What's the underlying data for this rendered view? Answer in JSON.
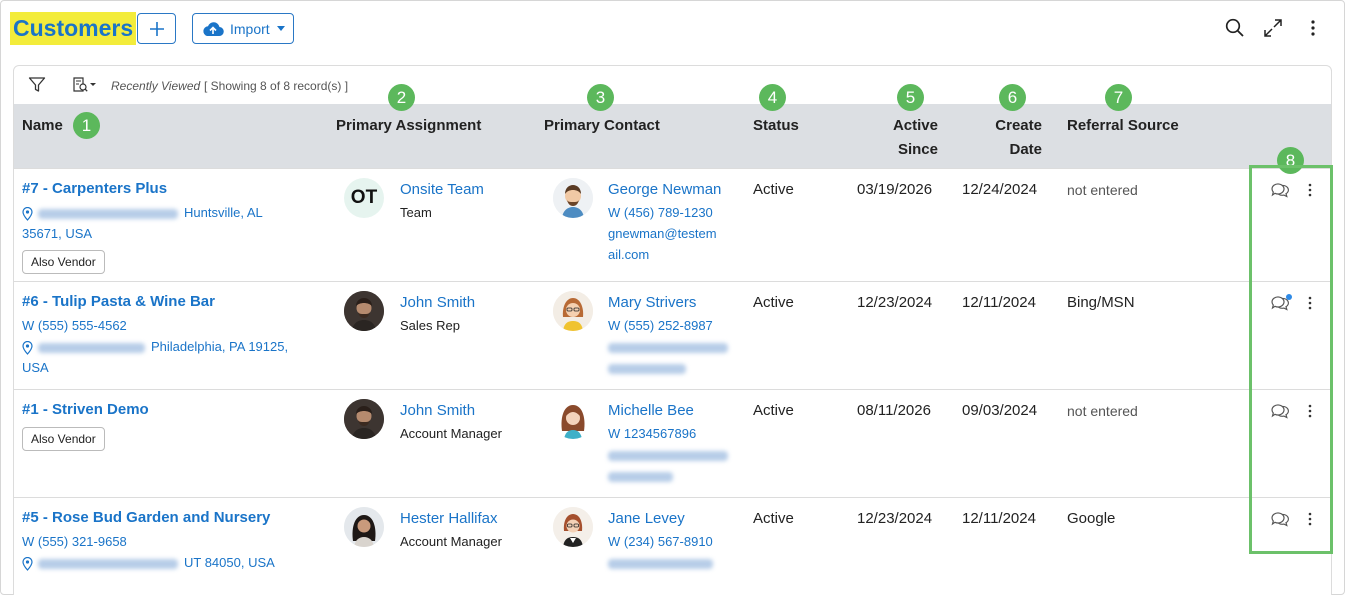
{
  "page": {
    "title": "Customers",
    "import_label": "Import"
  },
  "toolbar": {
    "recently_viewed": "Recently Viewed",
    "showing": "[ Showing 8 of 8 record(s) ]"
  },
  "columns": {
    "name": "Name",
    "primary_assignment": "Primary Assignment",
    "primary_contact": "Primary Contact",
    "status": "Status",
    "active_since_1": "Active",
    "active_since_2": "Since",
    "create_date_1": "Create",
    "create_date_2": "Date",
    "referral_source": "Referral Source"
  },
  "callouts": [
    "1",
    "2",
    "3",
    "4",
    "5",
    "6",
    "7",
    "8"
  ],
  "rows": [
    {
      "name": "#7 - Carpenters Plus",
      "address_city": "Huntsville, AL",
      "address_line2": "35671, USA",
      "tag": "Also Vendor",
      "assign_initials": "OT",
      "assign_name": "Onsite Team",
      "assign_role": "Team",
      "contact_name": "George Newman",
      "contact_phone": "W (456) 789-1230",
      "contact_email_1": "gnewman@testem",
      "contact_email_2": "ail.com",
      "status": "Active",
      "active_since": "03/19/2026",
      "create_date": "12/24/2024",
      "referral": "not entered"
    },
    {
      "name": "#6 - Tulip Pasta & Wine Bar",
      "phone": "W (555) 555-4562",
      "address_city": "Philadelphia, PA 19125,",
      "address_line2": "USA",
      "assign_name": "John Smith",
      "assign_role": "Sales Rep",
      "contact_name": "Mary Strivers",
      "contact_phone": "W (555) 252-8987",
      "status": "Active",
      "active_since": "12/23/2024",
      "create_date": "12/11/2024",
      "referral": "Bing/MSN"
    },
    {
      "name": "#1 - Striven Demo",
      "tag": "Also Vendor",
      "assign_name": "John Smith",
      "assign_role": "Account Manager",
      "contact_name": "Michelle Bee",
      "contact_phone": "W 1234567896",
      "status": "Active",
      "active_since": "08/11/2026",
      "create_date": "09/03/2024",
      "referral": "not entered"
    },
    {
      "name": "#5 - Rose Bud Garden and Nursery",
      "phone": "W (555) 321-9658",
      "address_city": "UT 84050, USA",
      "assign_name": "Hester Hallifax",
      "assign_role": "Account Manager",
      "contact_name": "Jane Levey",
      "contact_phone": "W (234) 567-8910",
      "status": "Active",
      "active_since": "12/23/2024",
      "create_date": "12/11/2024",
      "referral": "Google"
    }
  ],
  "colors": {
    "accent": "#1a74c8",
    "title_highlight": "#f3ec3b",
    "callout": "#5cb85c",
    "header_bg": "#dcdfe3"
  },
  "icons": [
    "plus-icon",
    "cloud-upload-icon",
    "search-icon",
    "expand-icon",
    "more-vertical-icon",
    "filter-icon",
    "saved-view-icon",
    "map-pin-icon",
    "chat-icon"
  ]
}
